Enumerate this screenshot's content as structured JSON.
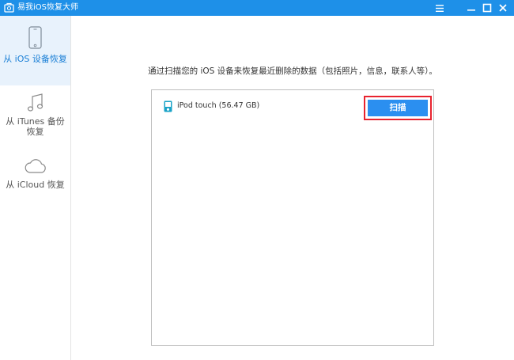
{
  "window": {
    "title": "易我iOS恢复大师",
    "menu_icon": "hamburger-menu-icon",
    "minimize_icon": "minimize-icon",
    "maximize_icon": "maximize-icon",
    "close_icon": "close-icon"
  },
  "sidebar": {
    "items": [
      {
        "label": "从 iOS 设备恢复",
        "icon": "phone-icon",
        "active": true
      },
      {
        "label": "从 iTunes 备份恢复",
        "icon": "music-note-icon",
        "active": false
      },
      {
        "label": "从 iCloud 恢复",
        "icon": "cloud-icon",
        "active": false
      }
    ]
  },
  "main": {
    "instruction": "通过扫描您的 iOS 设备来恢复最近删除的数据（包括照片，信息，联系人等）。",
    "device": {
      "name": "iPod touch (56.47 GB)",
      "icon": "ipod-icon"
    },
    "scan_label": "扫描"
  },
  "colors": {
    "titlebar": "#1e90e8",
    "accent": "#2b8ff0",
    "highlight_border": "#e8232f",
    "active_item_bg": "#e8f2fc"
  }
}
